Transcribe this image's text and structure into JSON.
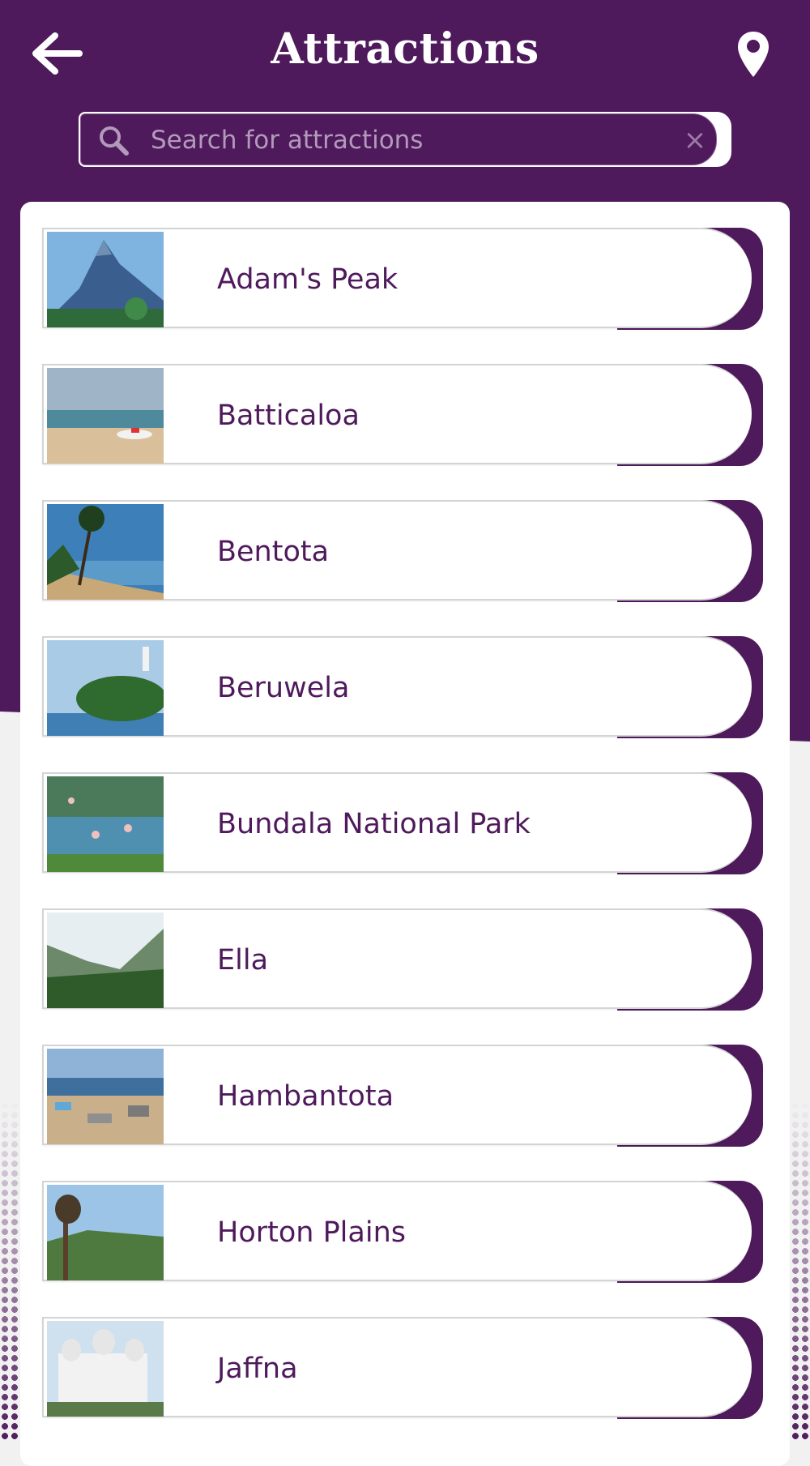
{
  "header": {
    "title": "Attractions",
    "back_icon": "arrow-left-icon",
    "location_icon": "map-pin-icon"
  },
  "search": {
    "placeholder": "Search for attractions",
    "value": "",
    "search_icon": "search-icon",
    "clear_icon": "close-icon",
    "clear_glyph": "×"
  },
  "colors": {
    "primary": "#4f1a5c",
    "background": "#f1f1f1",
    "card": "#ffffff",
    "text": "#4f1a5c"
  },
  "attractions": [
    {
      "label": "Adam's Peak",
      "thumbnail": "mountain peak under blue sky"
    },
    {
      "label": "Batticaloa",
      "thumbnail": "beach with boat"
    },
    {
      "label": "Bentota",
      "thumbnail": "palm trees by sea"
    },
    {
      "label": "Beruwela",
      "thumbnail": "lighthouse island"
    },
    {
      "label": "Bundala National Park",
      "thumbnail": "flamingos in lagoon"
    },
    {
      "label": "Ella",
      "thumbnail": "green valley"
    },
    {
      "label": "Hambantota",
      "thumbnail": "fishing harbour"
    },
    {
      "label": "Horton Plains",
      "thumbnail": "signpost and grassland"
    },
    {
      "label": "Jaffna",
      "thumbnail": "white library building"
    }
  ]
}
